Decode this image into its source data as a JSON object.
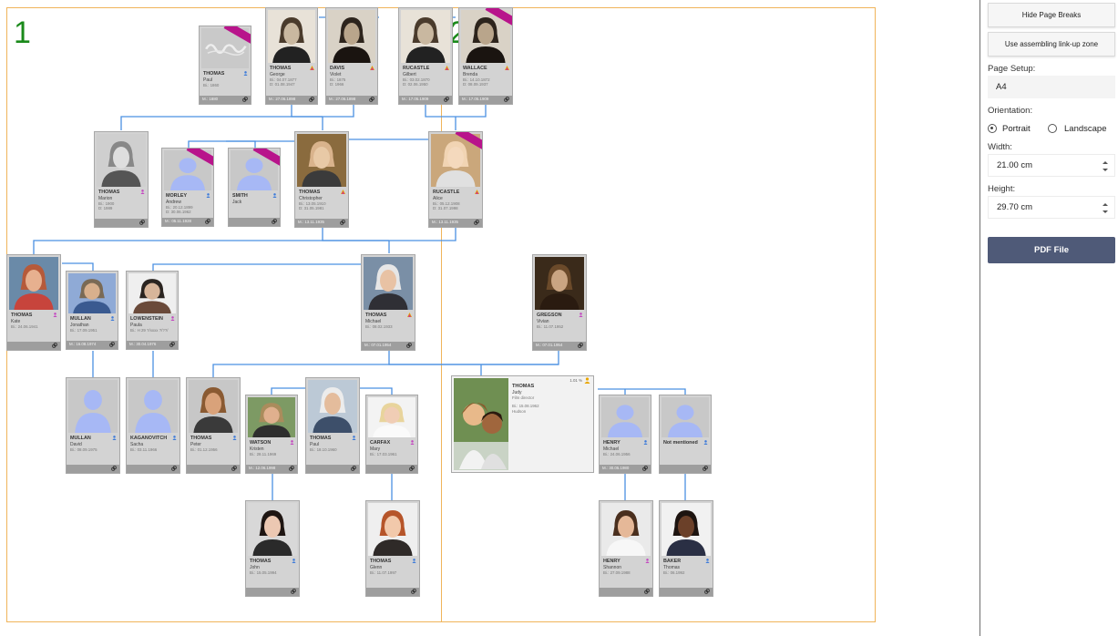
{
  "page_labels": [
    "1",
    "2"
  ],
  "persons": [
    {
      "surname": "THOMAS",
      "given": "Paul",
      "dates": [
        "Bi.: 1860"
      ],
      "marriage": "M.: 1880",
      "gender": "m",
      "photo": "signature",
      "ribbon": true
    },
    {
      "surname": "THOMAS",
      "given": "George",
      "dates": [
        "Bi.: 04.07.1877",
        "D: 01.08.1947"
      ],
      "marriage": "M.: 27.06.1898",
      "gender": "mf",
      "photo": "sepia-man"
    },
    {
      "surname": "DAVIS",
      "given": "Violet",
      "dates": [
        "Bi.: 1875",
        "D: 1966"
      ],
      "marriage": "M.: 27.06.1898",
      "gender": "mf",
      "photo": "sepia-woman"
    },
    {
      "surname": "RUCASTLE",
      "given": "Gilbert",
      "dates": [
        "Bi.: 03.02.1870",
        "D: 02.06.1950"
      ],
      "marriage": "M.: 17.05.1909",
      "gender": "mf",
      "photo": "sepia-man"
    },
    {
      "surname": "WALLACE",
      "given": "Brenda",
      "dates": [
        "Bi.: 14.10.1872",
        "D: 08.09.1937"
      ],
      "marriage": "M.: 17.05.1909",
      "gender": "mf",
      "photo": "sepia-woman",
      "ribbon": true
    },
    {
      "surname": "THOMAS",
      "given": "Marion",
      "dates": [
        "Bi.: 1900",
        "D: 1989"
      ],
      "marriage": "",
      "gender": "f",
      "photo": "bw-old"
    },
    {
      "surname": "MORLEY",
      "given": "Andrew",
      "dates": [
        "Bi.: 20.12.1899",
        "D: 30.06.1962"
      ],
      "marriage": "M.: 05.11.1928",
      "gender": "m",
      "photo": "silhouette",
      "ribbon": true
    },
    {
      "surname": "SMITH",
      "given": "Jack",
      "dates": [],
      "marriage": "",
      "gender": "m",
      "photo": "silhouette",
      "ribbon": true
    },
    {
      "surname": "THOMAS",
      "given": "Christopher",
      "dates": [
        "Bi.: 13.05.1910",
        "D: 31.05.1981"
      ],
      "marriage": "M.: 13.11.1935",
      "gender": "mf",
      "photo": "color-old-man"
    },
    {
      "surname": "RUCASTLE",
      "given": "Alice",
      "dates": [
        "Bi.: 05.12.1908",
        "D: 31.07.1998"
      ],
      "marriage": "M.: 13.11.1935",
      "gender": "mf",
      "photo": "color-old-woman",
      "ribbon": true
    },
    {
      "surname": "THOMAS",
      "given": "Kate",
      "dates": [
        "Bi.: 24.06.1941"
      ],
      "marriage": "",
      "gender": "f",
      "photo": "color-woman"
    },
    {
      "surname": "MULLAN",
      "given": "Jonathan",
      "dates": [
        "Bi.: 17.09.1951"
      ],
      "marriage": "M.: 16.08.1974",
      "gender": "m",
      "photo": "color-man"
    },
    {
      "surname": "LOWENSTEIN",
      "given": "Paula",
      "dates": [
        "Bi.: H 29 ?/xxxx  ?/??/"
      ],
      "marriage": "M.: 30.04.1976",
      "gender": "f",
      "photo": "color-woman2"
    },
    {
      "surname": "THOMAS",
      "given": "Michael",
      "dates": [
        "Bi.: 08.02.1933"
      ],
      "marriage": "M.: 07.01.1954",
      "gender": "mf",
      "photo": "color-old-man2"
    },
    {
      "surname": "GREGSON",
      "given": "Vivian",
      "dates": [
        "Bi.: 11.07.1952"
      ],
      "marriage": "M.: 07.01.1954",
      "gender": "f",
      "photo": "sepia-woman2"
    },
    {
      "surname": "MULLAN",
      "given": "David",
      "dates": [
        "Bi.: 08.09.1975"
      ],
      "marriage": "",
      "gender": "m",
      "photo": "silhouette"
    },
    {
      "surname": "KAGANOVITCH",
      "given": "Sacha",
      "dates": [
        "Bi.: 03.11.1966"
      ],
      "marriage": "",
      "gender": "m",
      "photo": "silhouette"
    },
    {
      "surname": "THOMAS",
      "given": "Peter",
      "dates": [
        "Bi.: 01.12.1956"
      ],
      "marriage": "",
      "gender": "m",
      "photo": "color-man2"
    },
    {
      "surname": "WATSON",
      "given": "Kristen",
      "dates": [
        "Bi.: 28.11.1969"
      ],
      "marriage": "M.: 12.06.1998",
      "gender": "f",
      "photo": "color-woman3"
    },
    {
      "surname": "THOMAS",
      "given": "Paul",
      "dates": [
        "Bi.: 18.10.1960"
      ],
      "marriage": "",
      "gender": "m",
      "photo": "color-man3"
    },
    {
      "surname": "CARFAX",
      "given": "Mary",
      "dates": [
        "Bi.: 17.03.1961"
      ],
      "marriage": "",
      "gender": "f",
      "photo": "color-woman4"
    },
    {
      "surname": "HENRY",
      "given": "Michael",
      "dates": [
        "Bi.: 24.06.1956"
      ],
      "marriage": "M.: 30.05.1980",
      "gender": "m",
      "photo": "silhouette"
    },
    {
      "surname": "Not mentioned",
      "given": "",
      "dates": [],
      "marriage": "",
      "gender": "m",
      "photo": "silhouette"
    },
    {
      "surname": "THOMAS",
      "given": "John",
      "dates": [
        "Bi.: 15.05.1994"
      ],
      "marriage": "",
      "gender": "m",
      "photo": "color-teen"
    },
    {
      "surname": "THOMAS",
      "given": "Glenn",
      "dates": [
        "Bi.: 11.07.1997"
      ],
      "marriage": "",
      "gender": "m",
      "photo": "color-teen2"
    },
    {
      "surname": "HENRY",
      "given": "Shannon",
      "dates": [
        "Bi.: 27.09.1988"
      ],
      "marriage": "",
      "gender": "f",
      "photo": "color-girl"
    },
    {
      "surname": "BAKER",
      "given": "Thomas",
      "dates": [
        "Bi.: 06.1992"
      ],
      "marriage": "",
      "gender": "m",
      "photo": "color-boy"
    }
  ],
  "focus_person": {
    "surname": "THOMAS",
    "given": "Judy",
    "occupation": "Film director",
    "birth": "Bi.: 15.08.1962",
    "place": "Hudson",
    "corner_tag": "1.01 %",
    "gender": "f",
    "photo": "color-focus"
  },
  "sidebar": {
    "hide_page_breaks": "Hide Page Breaks",
    "assembling": "Use assembling link-up zone",
    "page_setup_label": "Page Setup:",
    "page_setup_value": "A4",
    "orientation_label": "Orientation:",
    "portrait": "Portrait",
    "landscape": "Landscape",
    "orientation_selected": "portrait",
    "width_label": "Width:",
    "width_value": "21.00 cm",
    "height_label": "Height:",
    "height_value": "29.70 cm",
    "pdf_button": "PDF File"
  },
  "colors": {
    "male": "#3d7bd9",
    "female": "#c346c0",
    "connector": "#4a90e2",
    "page_frame": "#f0b45a",
    "page_label": "#1a8a1a",
    "ribbon": "#b8148b",
    "pdf_button": "#4f5a78"
  }
}
